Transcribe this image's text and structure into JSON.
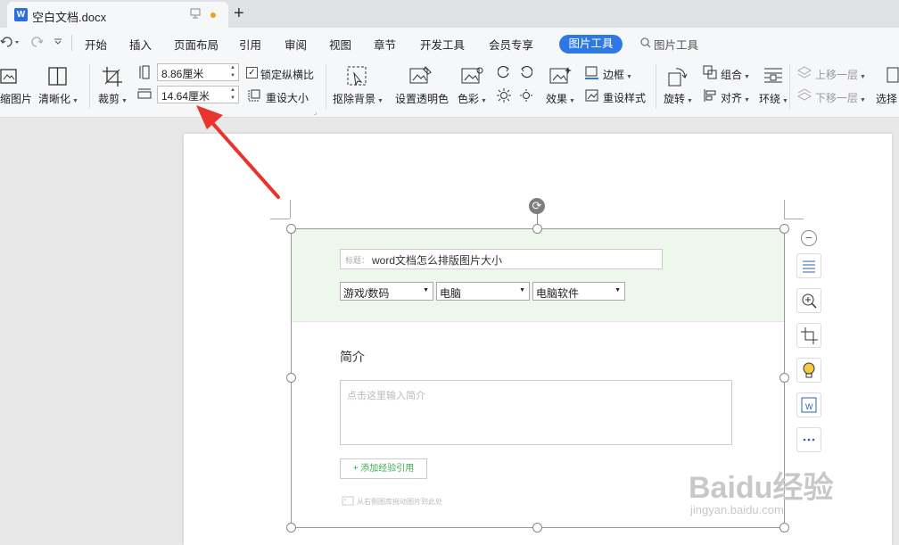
{
  "tabbar": {
    "doc_title": "空白文档.docx",
    "doc_icon": "W",
    "new_tab": "+"
  },
  "menubar": {
    "items": [
      "开始",
      "插入",
      "页面布局",
      "引用",
      "审阅",
      "视图",
      "章节",
      "开发工具",
      "会员专享"
    ],
    "active_tab": "图片工具",
    "search_label": "图片工具"
  },
  "ribbon": {
    "compress_label": "缩图片",
    "sharpen_label": "清晰化",
    "crop_label": "裁剪",
    "height_value": "8.86厘米",
    "width_value": "14.64厘米",
    "lock_ratio_label": "锁定纵横比",
    "lock_ratio_checked": true,
    "reset_size_label": "重设大小",
    "remove_bg_label": "抠除背景",
    "set_transparent_label": "设置透明色",
    "color_label": "色彩",
    "effects_label": "效果",
    "border_label": "边框",
    "reset_style_label": "重设样式",
    "rotate_label": "旋转",
    "group_label": "组合",
    "align_label": "对齐",
    "wrap_label": "环绕",
    "bring_forward_label": "上移一层",
    "send_backward_label": "下移一层",
    "select_label": "选择"
  },
  "form": {
    "title_prefix": "标题：",
    "title_value": "word文档怎么排版图片大小",
    "selects": [
      "游戏/数码",
      "电脑",
      "电脑软件"
    ],
    "intro_heading": "简介",
    "intro_placeholder": "点击这里输入简介",
    "add_button": "+ 添加经验引用",
    "drag_hint": "从右侧图库拖动图片到此处"
  },
  "watermark": {
    "brand": "Baidu经验",
    "url": "jingyan.baidu.com"
  },
  "colors": {
    "accent": "#2e78e6",
    "form_bg": "#eef7ec",
    "arrow": "#e8342c",
    "link_green": "#3cae4f"
  }
}
